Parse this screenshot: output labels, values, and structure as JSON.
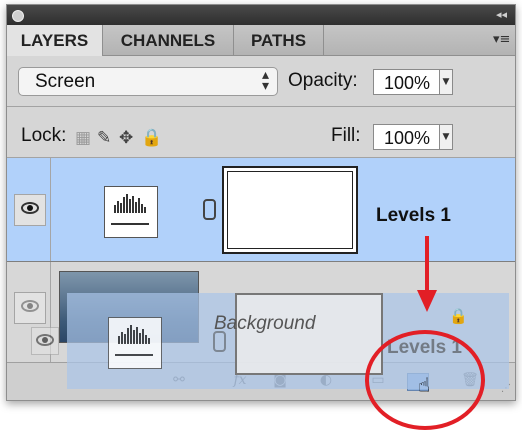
{
  "tabs": [
    {
      "label": "LAYERS",
      "active": true
    },
    {
      "label": "CHANNELS",
      "active": false
    },
    {
      "label": "PATHS",
      "active": false
    }
  ],
  "blend_mode": {
    "value": "Screen"
  },
  "opacity": {
    "label": "Opacity:",
    "value": "100%"
  },
  "lock": {
    "label": "Lock:"
  },
  "fill": {
    "label": "Fill:",
    "value": "100%"
  },
  "layers": [
    {
      "name": "Levels 1",
      "type": "adjustment",
      "selected": true,
      "visible": true
    },
    {
      "name": "Background",
      "type": "image",
      "selected": false,
      "visible": true
    }
  ],
  "drag_ghost": {
    "name": "Levels 1",
    "background_label": "Background"
  },
  "colors": {
    "selection": "#b1d1fa",
    "annotation_red": "#e21f26"
  },
  "icons": [
    "eye-icon",
    "chain-link-icon",
    "fx-icon",
    "add-mask-icon",
    "adjustment-icon",
    "group-folder-icon",
    "new-layer-icon",
    "trash-icon",
    "hand-cursor-icon",
    "lock-icon"
  ]
}
